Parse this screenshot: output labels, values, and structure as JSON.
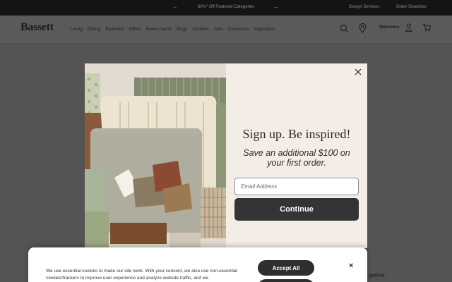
{
  "promo": {
    "prev_icon": "chevron-left-icon",
    "text": "30%* Off Featured Categories",
    "next_icon": "chevron-right-icon",
    "design_services": "Design Services",
    "order_swatches": "Order Swatches"
  },
  "header": {
    "logo": "Bassett",
    "nav": [
      "Living",
      "Dining",
      "Bedroom",
      "Office",
      "Home Decor",
      "Rugs",
      "Outdoor",
      "Sale",
      "Clearance",
      "Inspiration"
    ],
    "welcome": "Welcome",
    "icons": [
      "search-icon",
      "location-pin-icon",
      "user-icon",
      "cart-icon"
    ]
  },
  "modal": {
    "title": "Sign up. Be inspired!",
    "subtitle": "Save an additional $100 on your first order.",
    "email_placeholder": "Email Address",
    "continue_label": "Continue",
    "close_icon": "close-icon"
  },
  "cookie": {
    "text": "We use essential cookies to make our site work. With your consent, we also use non-essential cookies/trackers to improve user experience and analyze website traffic, and we",
    "accept_label": "Accept All",
    "close_label": "×"
  },
  "background": {
    "partial_text": "gether."
  },
  "colors": {
    "promo_bar": "#141414",
    "overlay": "#545454",
    "modal_bg": "#f3ede6",
    "button_dark": "#343434"
  }
}
